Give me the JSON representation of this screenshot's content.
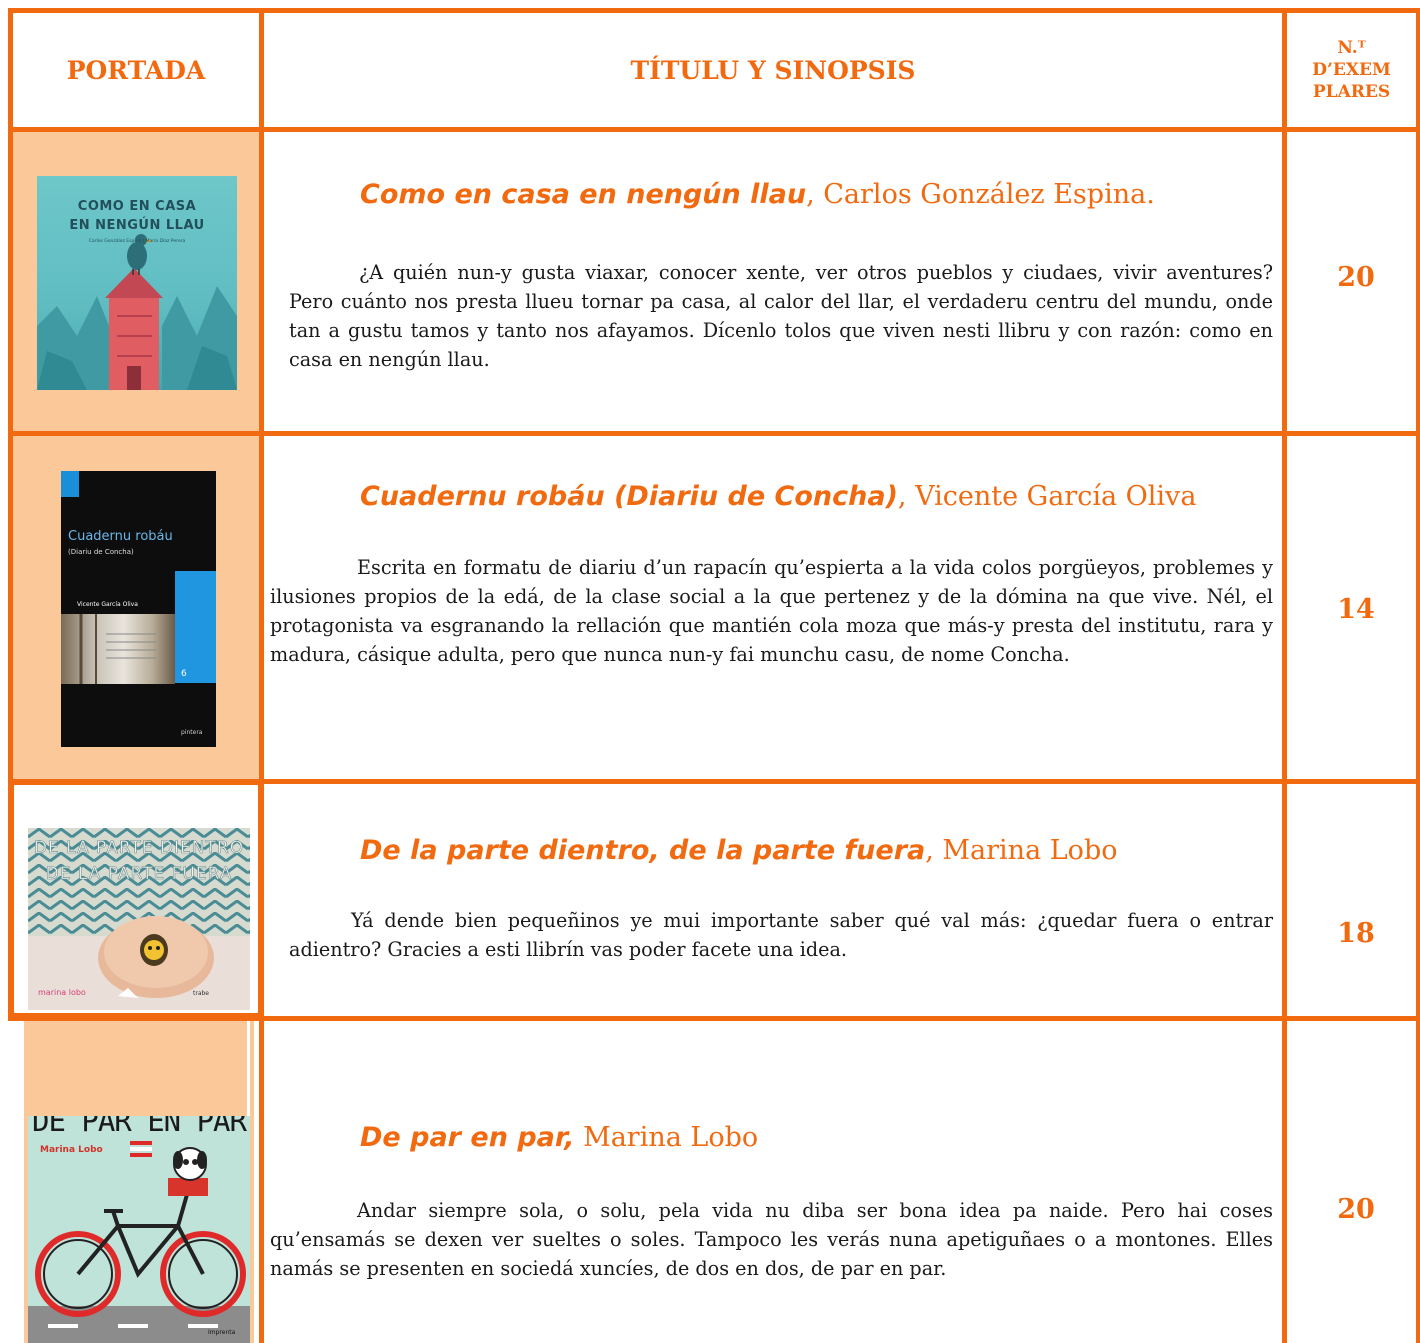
{
  "header": {
    "col_cover": "PORTADA",
    "col_title": "TÍTULU Y SINOPSIS",
    "col_count_line1": "N.ᵁ",
    "col_count_line2": "D’EXEM",
    "col_count_line3": "PLARES"
  },
  "books": [
    {
      "title": "Como en casa en nengún llau",
      "author": ", Carlos González Espina.",
      "synopsis": "¿A quién nun-y gusta viaxar, conocer xente, ver otros pueblos y ciudaes, vivir aventures? Pero cuánto nos presta llueu tornar pa casa, al calor del llar, el verdaderu centru del mundu, onde tan a gustu tamos y tanto nos afayamos. Dícenlo tolos que viven nesti llibru y con razón: como en casa en nengún llau.",
      "copies": "20",
      "cover": {
        "line1": "COMO EN CASA",
        "line2": "EN NENGÚN LLAU",
        "small": "Carlos González Espina  |  María Díaz Perera"
      }
    },
    {
      "title": "Cuadernu robáu (Diariu de Concha)",
      "author": ", Vicente García Oliva",
      "synopsis": "Escrita en formatu de diariu d’un rapacín qu’espierta a la vida colos porgüeyos, problemes y ilusiones propios de la edá, de la clase social a la que pertenez y de la dómina na que vive. Nél, el protagonista va esgranando la rellación que mantién cola moza que más-y presta del institutu, rara y madura, cásique adulta, pero que nunca nun-y fai munchu casu, de nome Concha.",
      "copies": "14",
      "cover": {
        "line1": "Cuadernu robáu",
        "line2": "(Diariu de Concha)",
        "author": "Vicente García Oliva",
        "number": "6",
        "publisher": "pintera"
      }
    },
    {
      "title": "De la parte dientro, de la parte fuera",
      "author": ", Marina Lobo",
      "synopsis": "Yá dende bien pequeñinos ye mui importante saber qué val más: ¿quedar fuera o entrar adientro? Gracies a esti llibrín vas poder facete una idea.",
      "copies": "18",
      "cover": {
        "line1": "DE LA PARTE DIENTRO",
        "line2": "DE LA PARTE FUERA",
        "author": "marina lobo",
        "publisher": "trabe"
      }
    },
    {
      "title": "De par en par,",
      "author": " Marina Lobo",
      "synopsis": "Andar siempre sola, o solu, pela vida nu diba ser bona idea pa naide. Pero hai coses qu’ensamás se dexen ver sueltes o soles. Tampoco les verás nuna apetiguñaes o a montones. Elles namás se presenten en sociedá xuncíes, de dos en dos, de par en par.",
      "copies": "20",
      "cover": {
        "line1": "DE PAR EN PAR",
        "author": "Marina Lobo",
        "publisher": "Imprenta"
      }
    }
  ],
  "colors": {
    "accent": "#f26a10",
    "cover_cell_bg": "#fbc999"
  }
}
